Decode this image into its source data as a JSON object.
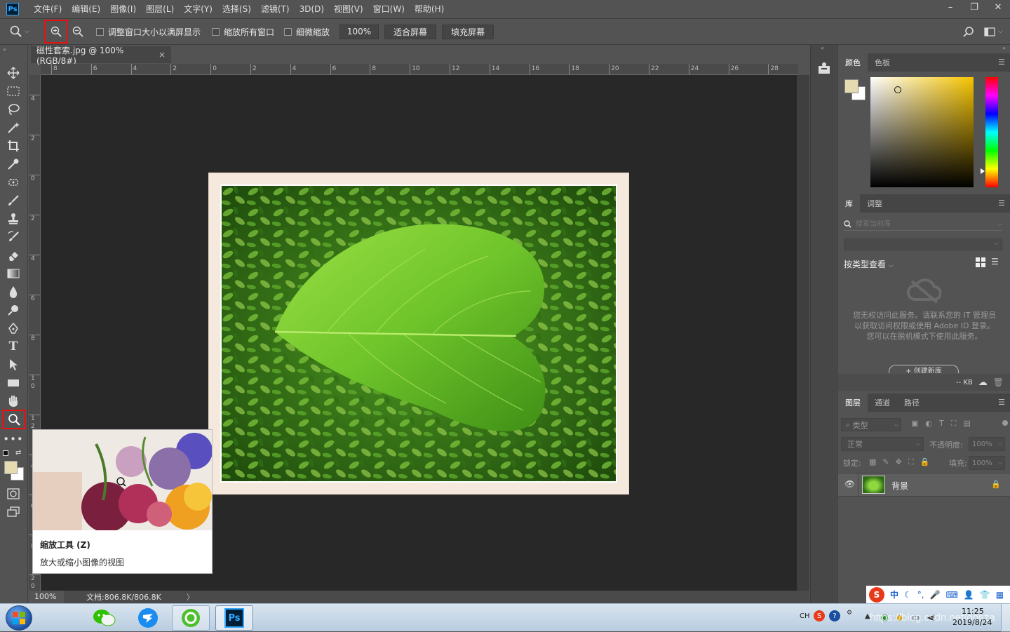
{
  "app": {
    "logo": "Ps"
  },
  "menu": [
    "文件(F)",
    "编辑(E)",
    "图像(I)",
    "图层(L)",
    "文字(Y)",
    "选择(S)",
    "滤镜(T)",
    "3D(D)",
    "视图(V)",
    "窗口(W)",
    "帮助(H)"
  ],
  "options": {
    "resize_windows": "调整窗口大小以满屏显示",
    "zoom_all": "缩放所有窗口",
    "scrubby_zoom": "细微缩放",
    "zoom_value": "100%",
    "fit_screen": "适合屏幕",
    "fill_screen": "填充屏幕"
  },
  "document": {
    "tab_title": "磁性套索.jpg @ 100%(RGB/8#)",
    "close": "×"
  },
  "ruler": {
    "top": [
      "8",
      "6",
      "4",
      "2",
      "0",
      "2",
      "4",
      "6",
      "8",
      "10",
      "12",
      "14",
      "16",
      "18",
      "20",
      "22",
      "24",
      "26",
      "28"
    ],
    "left": [
      "4",
      "2",
      "0",
      "2",
      "4",
      "6",
      "8",
      "1 0",
      "1 2",
      "1 4",
      "1 6",
      "1 8",
      "2 0"
    ]
  },
  "status": {
    "zoom": "100%",
    "doc": "文档:806.8K/806.8K",
    "arrow": "〉"
  },
  "tooltip": {
    "title": "缩放工具 (Z)",
    "desc": "放大或缩小图像的视图"
  },
  "colors": {
    "foreground": "#e6dbb0",
    "background": "#ffffff",
    "accent": "#e81010"
  },
  "color_panel": {
    "tabs": [
      "颜色",
      "色板"
    ]
  },
  "library_panel": {
    "tabs": [
      "库",
      "调整"
    ],
    "search_placeholder": "搜索当前库",
    "view_by": "按类型查看",
    "message": "您无权访问此服务。请联系您的 IT 管理员以获取访问权限或使用 Adobe ID 登录。您可以在脱机模式下使用此服务。",
    "create_button": "+ 创建新库",
    "kb": "-- KB"
  },
  "layers_panel": {
    "tabs": [
      "图层",
      "通道",
      "路径"
    ],
    "filter": "类型",
    "blend_mode": "正常",
    "opacity_label": "不透明度:",
    "opacity": "100%",
    "lock_label": "锁定:",
    "fill_label": "填充:",
    "fill": "100%",
    "layer_name": "背景"
  },
  "taskbar": {
    "ime": "中",
    "lang": "CH",
    "time": "11:25",
    "date": "2019/8/24",
    "watermark": "https://blog.csdn.net/qosza"
  }
}
